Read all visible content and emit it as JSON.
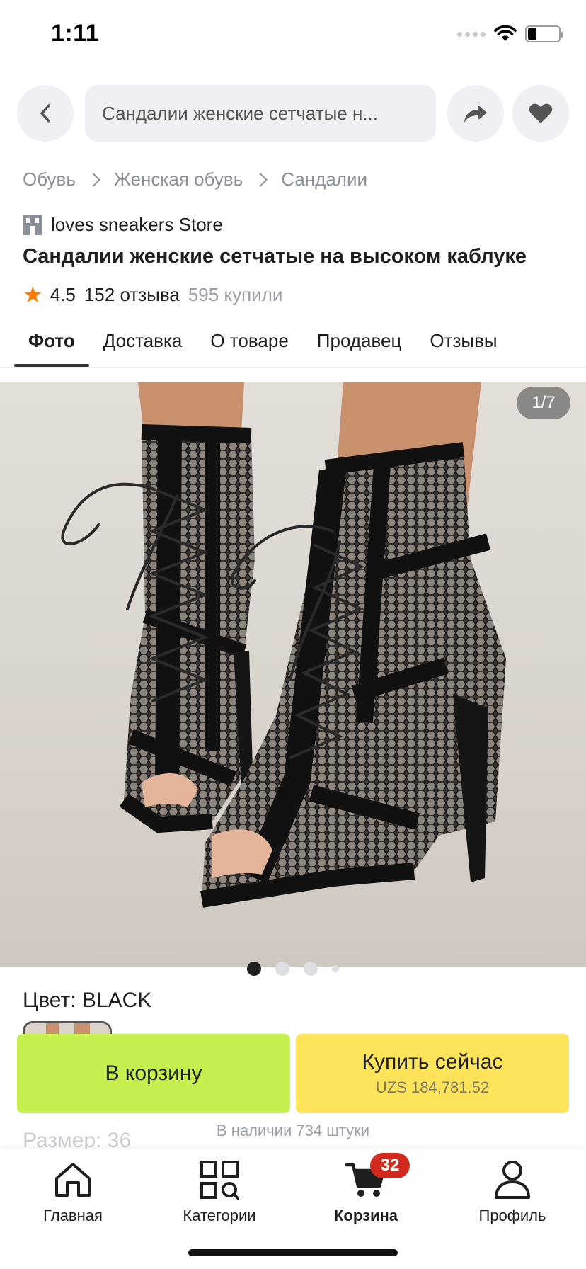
{
  "status_bar": {
    "time": "1:11"
  },
  "top_bar": {
    "search_text": "Сандалии женские сетчатые н..."
  },
  "breadcrumb": [
    "Обувь",
    "Женская обувь",
    "Сандалии"
  ],
  "store": {
    "name": "loves sneakers Store"
  },
  "product": {
    "title": "Сандалии женские сетчатые на высоком каблуке",
    "rating": "4.5",
    "reviews": "152 отзыва",
    "purchases": "595 купили"
  },
  "tabs": [
    {
      "label": "Фото",
      "active": true
    },
    {
      "label": "Доставка",
      "active": false
    },
    {
      "label": "О товаре",
      "active": false
    },
    {
      "label": "Продавец",
      "active": false
    },
    {
      "label": "Отзывы",
      "active": false
    }
  ],
  "gallery": {
    "counter": "1/7",
    "current": 1,
    "total": 7
  },
  "options": {
    "color_label": "Цвет: BLACK",
    "size_label": "Размер: 36"
  },
  "actions": {
    "cart_label": "В корзину",
    "buy_label": "Купить сейчас",
    "buy_price": "UZS 184,781.52",
    "stock": "В наличии 734 штуки"
  },
  "nav": {
    "items": [
      {
        "label": "Главная",
        "icon": "home-icon"
      },
      {
        "label": "Категории",
        "icon": "categories-icon"
      },
      {
        "label": "Корзина",
        "icon": "cart-icon",
        "active": true
      },
      {
        "label": "Профиль",
        "icon": "profile-icon"
      }
    ],
    "cart_badge": "32"
  },
  "colors": {
    "cart_button": "#c4ef4e",
    "buy_button": "#fde35a",
    "star": "#ff7a00",
    "badge": "#d1291e"
  }
}
